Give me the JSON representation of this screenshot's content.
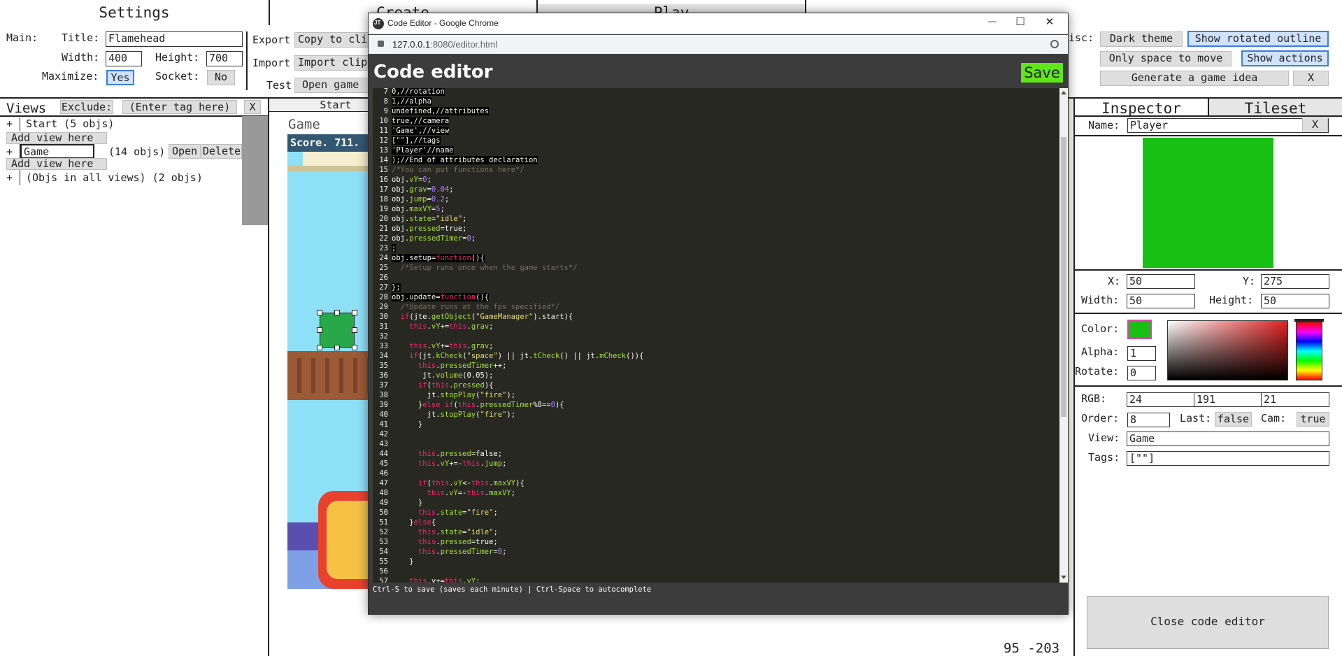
{
  "tabs": {
    "settings": "Settings",
    "create": "Create",
    "play": "Play"
  },
  "main_settings": {
    "main_label": "Main:",
    "title_label": "Title:",
    "title_value": "Flamehead",
    "width_label": "Width:",
    "width_value": "400",
    "height_label": "Height:",
    "height_value": "700",
    "maximize_label": "Maximize:",
    "maximize_value": "Yes",
    "socket_label": "Socket:",
    "socket_value": "No"
  },
  "export_group": {
    "export_label": "Export",
    "export_button": "Copy to clip",
    "import_label": "Import",
    "import_button": "Import clip",
    "test_label": "Test",
    "test_button": "Open game"
  },
  "misc": {
    "label": "isc:",
    "dark_theme": "Dark theme",
    "show_rotated_outline": "Show rotated outline",
    "only_space_to_move": "Only space to move",
    "show_actions": "Show actions",
    "generate_idea": "Generate a game idea",
    "close_x": "X"
  },
  "views": {
    "title": "Views",
    "exclude_button": "Exclude:",
    "tag_placeholder": "(Enter tag here)",
    "clear_button": "X",
    "rows": [
      {
        "expand": "+",
        "label": "Start (5 objs)"
      },
      {
        "add": "Add view here"
      },
      {
        "expand": "+",
        "name_value": "Game",
        "count": "(14 objs)",
        "open": "Open",
        "delete": "Delete"
      },
      {
        "add": "Add view here"
      },
      {
        "expand": "+",
        "label": "(Objs in all views) (2 objs)"
      }
    ]
  },
  "canvas": {
    "start_tab": "Start",
    "game_title": "Game",
    "score": "Score. 711.",
    "coords": "95 -203"
  },
  "chrome_window": {
    "title": "Code Editor - Google Chrome",
    "favicon_text": "JT",
    "url_host": "127.0.0.1",
    "url_rest": ":8080/editor.html",
    "minimize": "—",
    "maximize": "☐",
    "close": "✕"
  },
  "editor": {
    "heading": "Code editor",
    "save_button": "Save",
    "status_bar": "Ctrl-S to save (saves each minute) | Ctrl-Space to autocomplete",
    "lines": [
      {
        "n": "7",
        "t": "0,//rotation"
      },
      {
        "n": "8",
        "t": "1,//alpha"
      },
      {
        "n": "9",
        "t": "undefined,//attributes"
      },
      {
        "n": "10",
        "t": "true,//camera"
      },
      {
        "n": "11",
        "t": "'Game',//view"
      },
      {
        "n": "12",
        "t": "[\"\"],//tags"
      },
      {
        "n": "13",
        "t": "'Player'//name"
      },
      {
        "n": "14",
        "t": ");//End of attributes declaration"
      },
      {
        "n": "15",
        "t": "/*You can put functions here*/"
      },
      {
        "n": "16",
        "t": "obj.vY=0;"
      },
      {
        "n": "17",
        "t": "obj.grav=0.04;"
      },
      {
        "n": "18",
        "t": "obj.jump=0.2;"
      },
      {
        "n": "19",
        "t": "obj.maxVY=5;"
      },
      {
        "n": "20",
        "t": "obj.state=\"idle\";"
      },
      {
        "n": "21",
        "t": "obj.pressed=true;"
      },
      {
        "n": "22",
        "t": "obj.pressedTimer=0;"
      },
      {
        "n": "23",
        "t": ";"
      },
      {
        "n": "24",
        "t": "obj.setup=function(){"
      },
      {
        "n": "25",
        "t": "  /*Setup runs once when the game starts*/"
      },
      {
        "n": "26",
        "t": ""
      },
      {
        "n": "27",
        "t": "};"
      },
      {
        "n": "28",
        "t": "obj.update=function(){"
      },
      {
        "n": "29",
        "t": "  /*Update runs at the fps specified*/"
      },
      {
        "n": "30",
        "t": "  if(jte.getObject(\"GameManager\").start){"
      },
      {
        "n": "31",
        "t": "    this.vY+=this.grav;"
      },
      {
        "n": "32",
        "t": ""
      },
      {
        "n": "33",
        "t": "    this.vY+=this.grav;"
      },
      {
        "n": "34",
        "t": "    if(jt.kCheck(\"space\") || jt.tCheck() || jt.mCheck()){"
      },
      {
        "n": "35",
        "t": "      this.pressedTimer++;"
      },
      {
        "n": "36",
        "t": "       jt.volume(0.05);"
      },
      {
        "n": "37",
        "t": "      if(this.pressed){"
      },
      {
        "n": "38",
        "t": "        jt.stopPlay(\"fire\");"
      },
      {
        "n": "39",
        "t": "      }else if(this.pressedTimer%8==0){"
      },
      {
        "n": "40",
        "t": "        jt.stopPlay(\"fire\");"
      },
      {
        "n": "41",
        "t": "      }"
      },
      {
        "n": "42",
        "t": ""
      },
      {
        "n": "43",
        "t": ""
      },
      {
        "n": "44",
        "t": "      this.pressed=false;"
      },
      {
        "n": "45",
        "t": "      this.vY+=-this.jump;"
      },
      {
        "n": "46",
        "t": ""
      },
      {
        "n": "47",
        "t": "      if(this.vY<-this.maxVY){"
      },
      {
        "n": "48",
        "t": "        this.vY=-this.maxVY;"
      },
      {
        "n": "49",
        "t": "      }"
      },
      {
        "n": "50",
        "t": "      this.state=\"fire\";"
      },
      {
        "n": "51",
        "t": "    }else{"
      },
      {
        "n": "52",
        "t": "      this.state=\"idle\";"
      },
      {
        "n": "53",
        "t": "      this.pressed=true;"
      },
      {
        "n": "54",
        "t": "      this.pressedTimer=0;"
      },
      {
        "n": "55",
        "t": "    }"
      },
      {
        "n": "56",
        "t": ""
      },
      {
        "n": "57",
        "t": "    this.y+=this.vY;"
      }
    ]
  },
  "inspector": {
    "tab_inspector": "Inspector",
    "tab_tileset": "Tileset",
    "name_label": "Name:",
    "name_value": "Player",
    "name_clear": "X",
    "x_label": "X:",
    "x_value": "50",
    "y_label": "Y:",
    "y_value": "275",
    "width_label": "Width:",
    "width_value": "50",
    "height_label": "Height:",
    "height_value": "50",
    "color_label": "Color:",
    "color_hex": "#18bf15",
    "alpha_label": "Alpha:",
    "alpha_value": "1",
    "rotate_label": "Rotate:",
    "rotate_value": "0",
    "rgb_label": "RGB:",
    "r": "24",
    "g": "191",
    "b": "21",
    "order_label": "Order:",
    "order_value": "8",
    "last_label": "Last:",
    "last_value": "false",
    "cam_label": "Cam:",
    "cam_value": "true",
    "view_label": "View:",
    "view_value": "Game",
    "tags_label": "Tags:",
    "tags_value": "[\"\"]",
    "close_code_editor": "Close code editor"
  },
  "colors": {
    "editor_bg": "#272822",
    "chrome_frame": "#3c3c3c",
    "save_green": "#5fe619",
    "player_green": "#18bf15",
    "sky": "#8ee0f7"
  }
}
